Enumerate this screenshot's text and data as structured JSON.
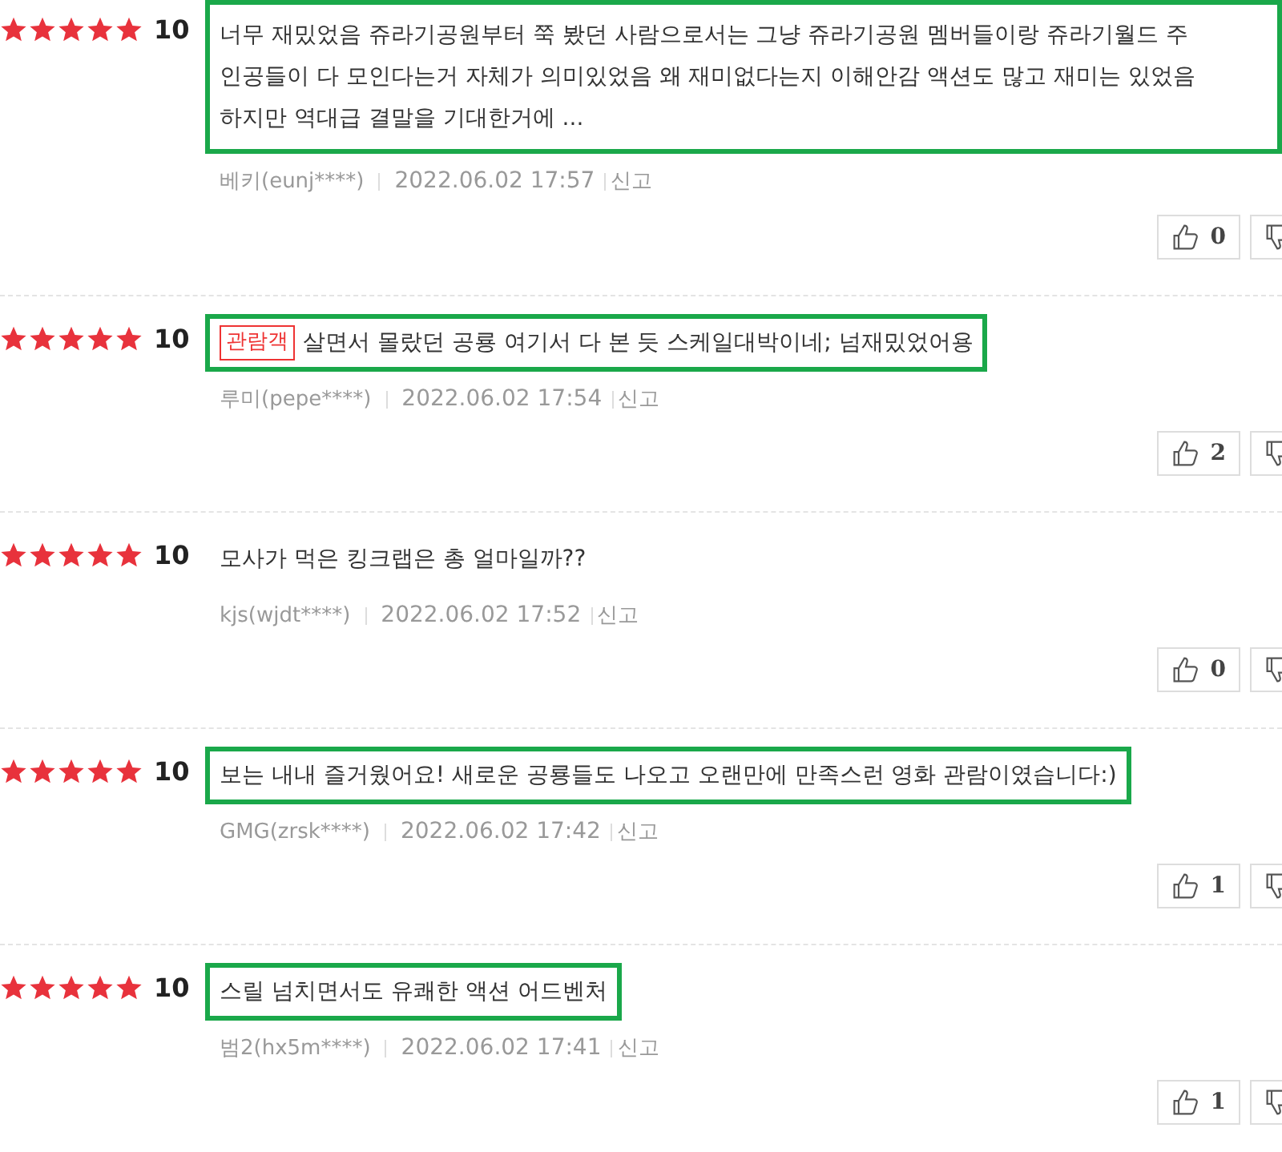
{
  "reviews": [
    {
      "stars": 5,
      "score": "10",
      "highlighted": true,
      "lines": [
        "너무 재밌었음 쥬라기공원부터 쭉 봤던 사람으로서는 그냥 쥬라기공원 멤버들이랑 쥬라기월드 주",
        "인공들이 다 모인다는거 자체가 의미있었음 왜 재미없다는지 이해안감 액션도 많고 재미는 있었음",
        "하지만 역대급 결말을 기대한거에 ..."
      ],
      "user": "베키(eunj****)",
      "date": "2022.06.02 17:57",
      "report": "신고",
      "likes": "0"
    },
    {
      "stars": 5,
      "score": "10",
      "highlighted": true,
      "badge": "관람객",
      "lines": [
        "살면서 몰랐던 공룡 여기서 다 본 듯 스케일대박이네; 넘재밌었어용"
      ],
      "user": "루미(pepe****)",
      "date": "2022.06.02 17:54",
      "report": "신고",
      "likes": "2"
    },
    {
      "stars": 5,
      "score": "10",
      "highlighted": false,
      "lines": [
        "모사가 먹은 킹크랩은 총 얼마일까??"
      ],
      "user": "kjs(wjdt****)",
      "date": "2022.06.02 17:52",
      "report": "신고",
      "likes": "0"
    },
    {
      "stars": 5,
      "score": "10",
      "highlighted": true,
      "lines": [
        "보는 내내 즐거웠어요! 새로운 공룡들도 나오고 오랜만에 만족스런 영화 관람이였습니다:)"
      ],
      "user": "GMG(zrsk****)",
      "date": "2022.06.02 17:42",
      "report": "신고",
      "likes": "1"
    },
    {
      "stars": 5,
      "score": "10",
      "highlighted": true,
      "lines": [
        "스릴 넘치면서도 유쾌한 액션 어드벤처"
      ],
      "user": "범2(hx5m****)",
      "date": "2022.06.02 17:41",
      "report": "신고",
      "likes": "1"
    }
  ]
}
